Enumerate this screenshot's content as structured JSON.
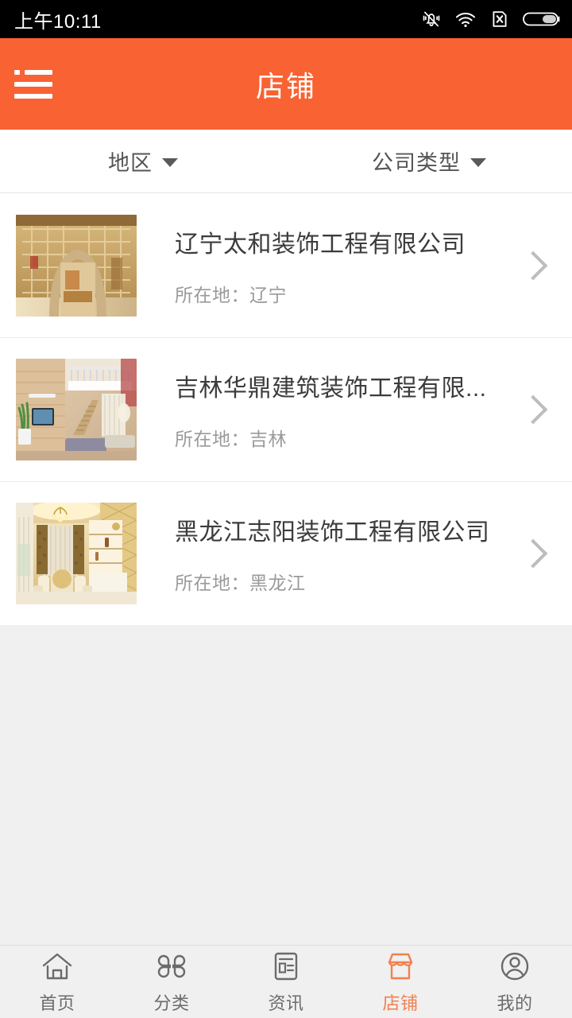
{
  "statusbar": {
    "time": "上午10:11",
    "icons": [
      "mute-icon",
      "wifi-icon",
      "no-sim-icon",
      "battery-icon"
    ]
  },
  "header": {
    "title": "店铺",
    "menu_icon": "hamburger-menu-icon",
    "bg_color": "#f96232"
  },
  "filters": [
    {
      "label": "地区",
      "icon": "chevron-down-icon"
    },
    {
      "label": "公司类型",
      "icon": "chevron-down-icon"
    }
  ],
  "list": {
    "items": [
      {
        "title": "辽宁太和装饰工程有限公司",
        "location": "所在地：辽宁",
        "thumb": "chinese-lattice-moon-gate-interior",
        "chevron": "chevron-right-icon"
      },
      {
        "title": "吉林华鼎建筑装饰工程有限...",
        "location": "所在地：吉林",
        "thumb": "modern-double-height-living-room",
        "chevron": "chevron-right-icon"
      },
      {
        "title": "黑龙江志阳装饰工程有限公司",
        "location": "所在地：黑龙江",
        "thumb": "european-golden-dining-room",
        "chevron": "chevron-right-icon"
      }
    ]
  },
  "tabbar": {
    "active_color": "#f08050",
    "inactive_color": "#6b6b6b",
    "items": [
      {
        "label": "首页",
        "icon": "home-icon",
        "active": false
      },
      {
        "label": "分类",
        "icon": "category-icon",
        "active": false
      },
      {
        "label": "资讯",
        "icon": "news-icon",
        "active": false
      },
      {
        "label": "店铺",
        "icon": "shop-icon",
        "active": true
      },
      {
        "label": "我的",
        "icon": "profile-icon",
        "active": false
      }
    ]
  }
}
